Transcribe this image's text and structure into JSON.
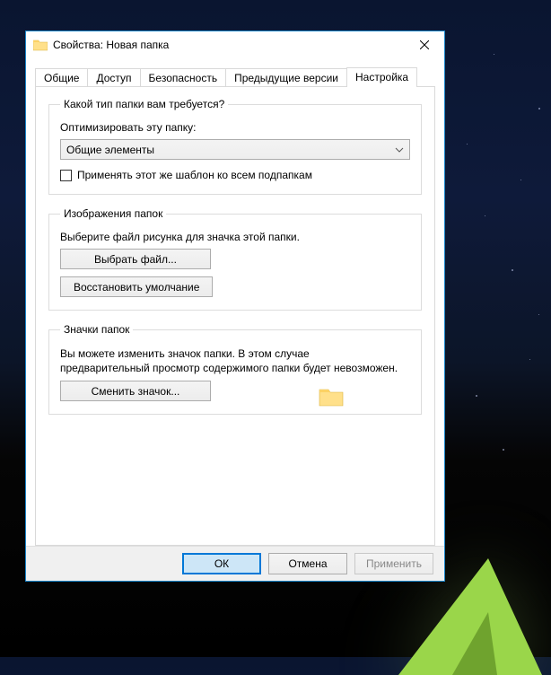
{
  "window": {
    "title": "Свойства: Новая папка"
  },
  "tabs": {
    "general": "Общие",
    "sharing": "Доступ",
    "security": "Безопасность",
    "previous": "Предыдущие версии",
    "customize": "Настройка"
  },
  "group_type": {
    "legend": "Какой тип папки вам требуется?",
    "optimize_label": "Оптимизировать эту папку:",
    "combo_value": "Общие элементы",
    "apply_sub": "Применять этот же шаблон ко всем подпапкам"
  },
  "group_images": {
    "legend": "Изображения папок",
    "desc": "Выберите файл рисунка для значка этой папки.",
    "choose_file": "Выбрать файл...",
    "restore_default": "Восстановить умолчание"
  },
  "group_icons": {
    "legend": "Значки папок",
    "desc": "Вы можете изменить значок папки. В этом случае предварительный просмотр содержимого папки будет невозможен.",
    "change_icon": "Сменить значок..."
  },
  "buttons": {
    "ok": "ОК",
    "cancel": "Отмена",
    "apply": "Применить"
  }
}
